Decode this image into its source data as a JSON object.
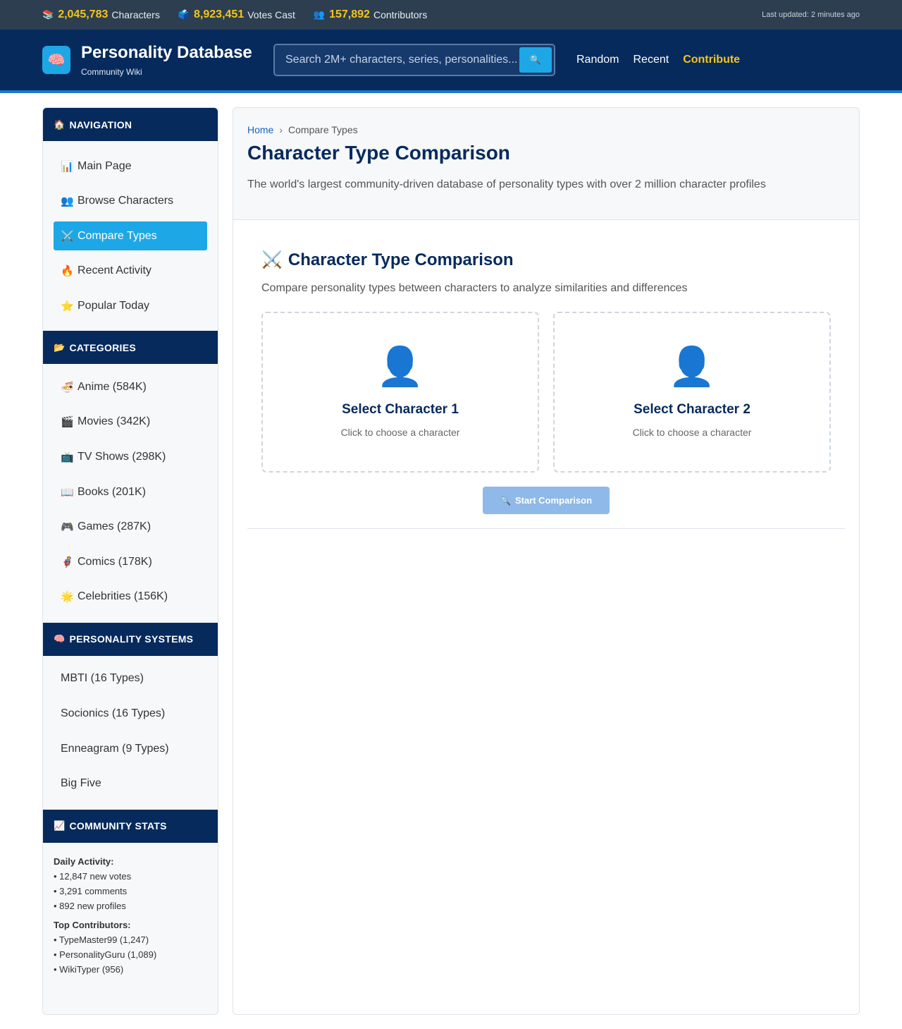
{
  "topbar": {
    "stats": [
      {
        "icon": "books-icon",
        "value": "2,045,783",
        "label": "Characters"
      },
      {
        "icon": "ballot-box-icon",
        "value": "8,923,451",
        "label": "Votes Cast"
      },
      {
        "icon": "people-icon",
        "value": "157,892",
        "label": "Contributors"
      }
    ],
    "updated": "Last updated: 2 minutes ago"
  },
  "header": {
    "title": "Personality Database",
    "subtitle": "Community Wiki",
    "search_placeholder": "Search 2M+ characters, series, personalities...",
    "nav": [
      "Random",
      "Recent",
      "Contribute"
    ]
  },
  "sidebar": {
    "navigation": {
      "heading": "NAVIGATION",
      "items": [
        {
          "icon": "chart-icon",
          "label": "Main Page"
        },
        {
          "icon": "people-icon",
          "label": "Browse Characters"
        },
        {
          "icon": "crossed-swords-icon",
          "label": "Compare Types",
          "active": true
        },
        {
          "icon": "fire-icon",
          "label": "Recent Activity"
        },
        {
          "icon": "star-icon",
          "label": "Popular Today"
        }
      ]
    },
    "categories": {
      "heading": "CATEGORIES",
      "items": [
        {
          "icon": "ramen-icon",
          "label": "Anime (584K)"
        },
        {
          "icon": "clapper-icon",
          "label": "Movies (342K)"
        },
        {
          "icon": "tv-icon",
          "label": "TV Shows (298K)"
        },
        {
          "icon": "book-icon",
          "label": "Books (201K)"
        },
        {
          "icon": "gamepad-icon",
          "label": "Games (287K)"
        },
        {
          "icon": "superhero-icon",
          "label": "Comics (178K)"
        },
        {
          "icon": "sparkle-star-icon",
          "label": "Celebrities (156K)"
        }
      ]
    },
    "systems": {
      "heading": "PERSONALITY SYSTEMS",
      "items": [
        "MBTI (16 Types)",
        "Socionics (16 Types)",
        "Enneagram (9 Types)",
        "Big Five"
      ]
    },
    "community": {
      "heading": "COMMUNITY STATS",
      "daily_label": "Daily Activity:",
      "daily": [
        "• 12,847 new votes",
        "• 3,291 comments",
        "• 892 new profiles"
      ],
      "top_label": "Top Contributors:",
      "top": [
        "• TypeMaster99 (1,247)",
        "• PersonalityGuru (1,089)",
        "• WikiTyper (956)"
      ]
    }
  },
  "main": {
    "breadcrumb": {
      "home": "Home",
      "sep": "›",
      "current": "Compare Types"
    },
    "title": "Character Type Comparison",
    "description": "The world's largest community-driven database of personality types with over 2 million character profiles",
    "compare": {
      "title": "Character Type Comparison",
      "description": "Compare personality types between characters to analyze similarities and differences",
      "slot1": {
        "name": "Select Character 1",
        "hint": "Click to choose a character"
      },
      "slot2": {
        "name": "Select Character 2",
        "hint": "Click to choose a character"
      },
      "button": "Start Comparison"
    }
  },
  "icons": {
    "books": "📚",
    "ballot": "🗳️",
    "people": "👥",
    "search": "🔍",
    "brain": "🧠",
    "home": "🏠",
    "chart": "📊",
    "swords": "⚔️",
    "fire": "🔥",
    "star": "⭐",
    "folder": "📂",
    "ramen": "🍜",
    "clapper": "🎬",
    "tv": "📺",
    "book": "📖",
    "gamepad": "🎮",
    "hero": "🦸",
    "sparkle": "🌟",
    "trend": "📈",
    "person": "👤"
  }
}
